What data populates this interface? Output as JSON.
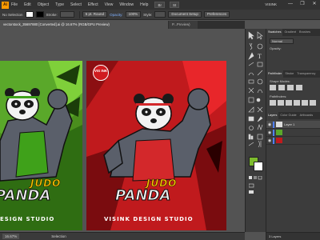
{
  "app": {
    "logo": "Ai",
    "user": "VISINK"
  },
  "menu": [
    "File",
    "Edit",
    "Object",
    "Type",
    "Select",
    "Effect",
    "View",
    "Window",
    "Help"
  ],
  "menu_extras": {
    "bridge": "Br",
    "stock": "St"
  },
  "window_controls": [
    "—",
    "❐",
    "✕"
  ],
  "controlbar": {
    "selection_label": "No Selection",
    "stroke_label": "Stroke:",
    "stroke_weight": "",
    "brush_value": "5 pt. Round",
    "opacity_label": "Opacity:",
    "opacity_value": "100%",
    "style_label": "Style:",
    "document_setup": "Document Setup",
    "preferences": "Preferences"
  },
  "tabs": [
    "vectorstock_35697880 [Converted].ai @ 16.67% (RGB/GPU Preview)",
    "P...Preview)"
  ],
  "artboards": {
    "green": {
      "title_top": "JUDO",
      "title_main": "PANDA",
      "studio": "ESIGN STUDIO"
    },
    "red": {
      "title_top": "JUDO",
      "title_main": "PANDA",
      "studio": "VISINK DESIGN STUDIO",
      "badge": "VIS INK"
    }
  },
  "statusbar": {
    "zoom": "16.67%",
    "tool": "Selection"
  },
  "panels": {
    "top_tabs": [
      "Swatches",
      "Gradient",
      "Brushes"
    ],
    "blend_mode": "Normal",
    "opacity_label": "Opacity:",
    "mid_tabs": [
      "Pathfinder",
      "Stroke",
      "Transparency"
    ],
    "shape_modes_label": "Shape Modes:",
    "pathfinders_label": "Pathfinders:",
    "layer_tabs": [
      "Layers",
      "Color Guide",
      "Artboards"
    ],
    "layers": [
      {
        "name": "Layer 1",
        "color": "#4f7fff",
        "selected": true
      },
      {
        "name": "",
        "color": "#4f7fff",
        "selected": false
      },
      {
        "name": "",
        "color": "#4f7fff",
        "selected": false
      }
    ],
    "footer": "3 Layers"
  },
  "colors": {
    "green_artboard": "#4a8d1d",
    "red_artboard": "#c01a1d",
    "ui_dark": "#323232",
    "accent_orange": "#ff9a00",
    "fill_color": "#7dbb2d"
  }
}
